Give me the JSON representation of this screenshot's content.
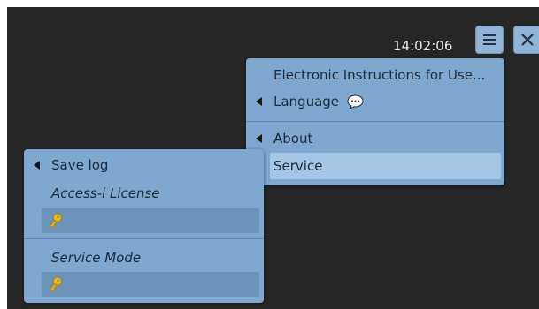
{
  "header": {
    "clock": "14:02:06",
    "menu_icon": "hamburger-icon",
    "close_icon": "close-icon"
  },
  "main_menu": {
    "items": [
      {
        "label": "Electronic Instructions for Use...",
        "has_submenu": false
      },
      {
        "label": "Language",
        "has_submenu": true,
        "icon": "speech-bubble-icon"
      },
      {
        "label": "About",
        "has_submenu": true
      },
      {
        "label": "Service",
        "has_submenu": false,
        "selected": true
      }
    ]
  },
  "service_menu": {
    "save_log_label": "Save log",
    "access_license_label": "Access-i License",
    "service_mode_label": "Service Mode",
    "key_icon": "key-icon"
  },
  "colors": {
    "background": "#262626",
    "panel": "#7ea8cf",
    "selected": "#a4c7e6",
    "field": "#6c93b9",
    "key": "#f5b800"
  }
}
